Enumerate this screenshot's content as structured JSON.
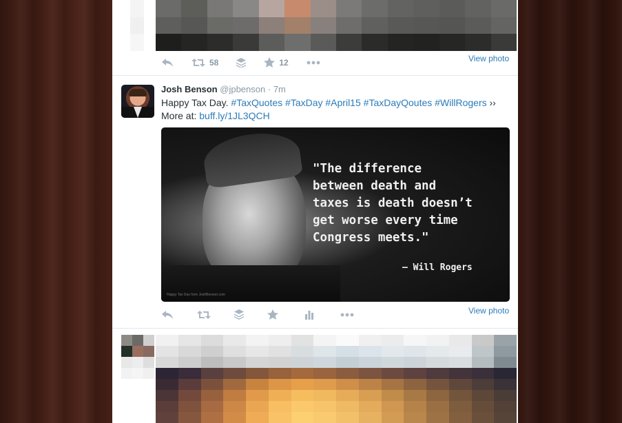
{
  "top_tweet": {
    "actions": {
      "retweet_count": "58",
      "favorite_count": "12"
    },
    "view_photo": "View photo"
  },
  "tweet": {
    "name": "Josh Benson",
    "handle": "@jpbenson",
    "separator": "·",
    "time": "7m",
    "text_prefix": "Happy Tax Day. ",
    "hashtags": [
      "#TaxQuotes",
      "#TaxDay",
      "#April15",
      "#TaxDayQoutes",
      "#WillRogers"
    ],
    "text_suffix": " ››",
    "more_at": "More at: ",
    "link": "buff.ly/1JL3QCH",
    "media": {
      "quote": "\"The difference\nbetween death and\ntaxes is death doesn’t\nget worse every time\nCongress meets.\"",
      "attribution": "— Will Rogers",
      "credit": "Happy Tax Day from JoshBenson.com"
    },
    "view_photo": "View photo"
  },
  "icons": [
    "reply-icon",
    "retweet-icon",
    "buffer-icon",
    "favorite-icon",
    "analytics-icon",
    "more-icon"
  ],
  "colors": {
    "link": "#2b7bb9",
    "action_icon": "#a9b6c2",
    "text": "#292f33",
    "muted": "#8899a6"
  }
}
